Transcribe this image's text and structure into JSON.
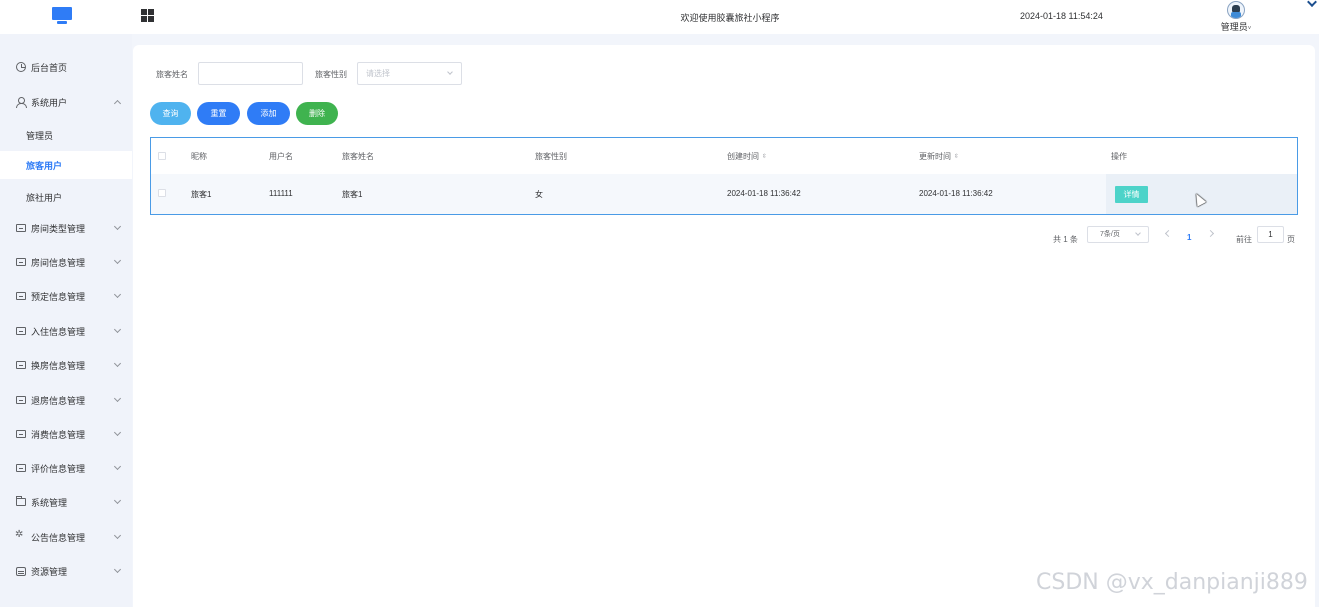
{
  "header": {
    "welcome_text": "欢迎使用胶囊旅社小程序",
    "datetime": "2024-01-18 11:54:24",
    "user_name": "管理员",
    "user_caret": "˅"
  },
  "sidebar": {
    "items": [
      {
        "label": "后台首页",
        "icon": "clock-icon"
      },
      {
        "label": "系统用户",
        "icon": "user-icon",
        "expanded": true
      },
      {
        "label": "房间类型管理",
        "icon": "card-icon"
      },
      {
        "label": "房间信息管理",
        "icon": "card-icon"
      },
      {
        "label": "预定信息管理",
        "icon": "card-icon"
      },
      {
        "label": "入住信息管理",
        "icon": "card-icon"
      },
      {
        "label": "换房信息管理",
        "icon": "card-icon"
      },
      {
        "label": "退房信息管理",
        "icon": "card-icon"
      },
      {
        "label": "消费信息管理",
        "icon": "card-icon"
      },
      {
        "label": "评价信息管理",
        "icon": "card-icon"
      },
      {
        "label": "系统管理",
        "icon": "folder-icon"
      },
      {
        "label": "公告信息管理",
        "icon": "spark-icon"
      },
      {
        "label": "资源管理",
        "icon": "resource-icon"
      }
    ],
    "sub_items": [
      {
        "label": "管理员",
        "active": false
      },
      {
        "label": "旅客用户",
        "active": true
      },
      {
        "label": "旅社用户",
        "active": false
      }
    ]
  },
  "filters": {
    "name_label": "旅客姓名",
    "name_value": "",
    "gender_label": "旅客性别",
    "gender_placeholder": "请选择"
  },
  "buttons": {
    "query": "查询",
    "reset": "重置",
    "add": "添加",
    "delete": "删除"
  },
  "colors": {
    "query": "#4fb3ef",
    "reset": "#2f7cf6",
    "add": "#2f7cf6",
    "delete": "#3fb34f",
    "detail": "#4dd3c9",
    "accent": "#2f7cf6"
  },
  "table": {
    "columns": [
      "昵称",
      "用户名",
      "旅客姓名",
      "旅客性别",
      "创建时间",
      "更新时间",
      "操作"
    ],
    "rows": [
      {
        "nickname": "旅客1",
        "username": "111111",
        "name": "旅客1",
        "gender": "女",
        "created": "2024-01-18 11:36:42",
        "updated": "2024-01-18 11:36:42",
        "action": "详情"
      }
    ]
  },
  "pagination": {
    "total_text": "共 1 条",
    "page_size": "7条/页",
    "current_page": "1",
    "goto_label": "前往",
    "goto_value": "1",
    "page_suffix": "页"
  },
  "watermark": "CSDN @vx_danpianji889"
}
